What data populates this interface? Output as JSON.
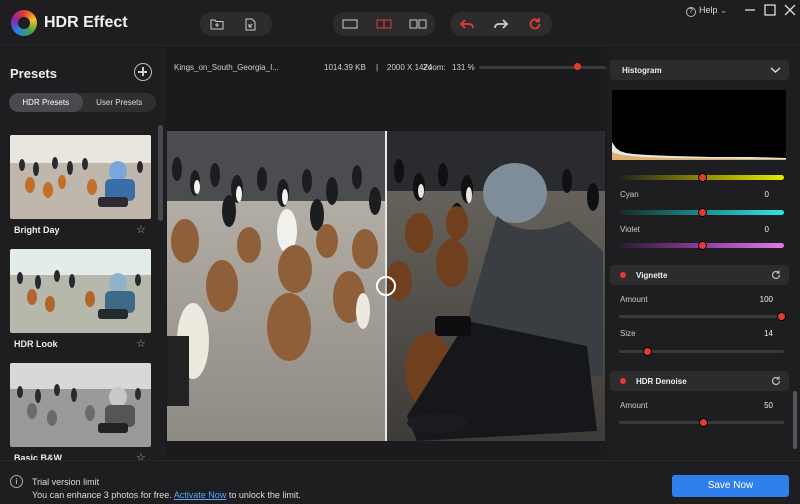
{
  "app": {
    "title": "HDR Effect"
  },
  "toolbar": {
    "help_label": "Help",
    "colors": {
      "undo": "#e53935",
      "refresh": "#e53935",
      "active_view": "#e53935"
    }
  },
  "presets": {
    "title": "Presets",
    "tabs": [
      {
        "label": "HDR Presets",
        "active": true
      },
      {
        "label": "User Presets",
        "active": false
      }
    ],
    "items": [
      {
        "label": "Bright Day"
      },
      {
        "label": "HDR Look"
      },
      {
        "label": "Basic B&W"
      }
    ]
  },
  "file_info": {
    "name": "Kings_on_South_Georgia_I...",
    "size": "1014.39 KB",
    "separator": "|",
    "dimensions": "2000 X 1424",
    "zoom_label": "Zoom:",
    "zoom_value": "131 %"
  },
  "right_panel": {
    "histogram_title": "Histogram",
    "rows": [
      {
        "label": "Cyan",
        "value": "0"
      },
      {
        "label": "Violet",
        "value": "0"
      }
    ],
    "vignette": {
      "title": "Vignette",
      "rows": [
        {
          "label": "Amount",
          "value": "100"
        },
        {
          "label": "Size",
          "value": "14"
        }
      ]
    },
    "denoise": {
      "title": "HDR Denoise",
      "rows": [
        {
          "label": "Amount",
          "value": "50"
        }
      ]
    }
  },
  "footer": {
    "trial_title": "Trial version limit",
    "trial_prefix": "You can enhance 3 photos for free.",
    "trial_link": "Activate Now",
    "trial_suffix": "to unlock the limit.",
    "save_label": "Save Now",
    "save_color": "#2f80ed"
  }
}
